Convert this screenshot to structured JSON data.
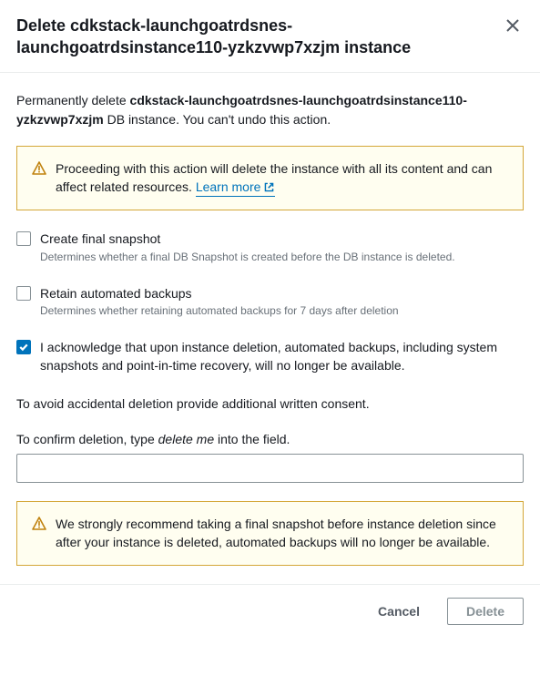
{
  "header": {
    "title": "Delete cdkstack-launchgoatrdsnes-launchgoatrdsinstance110-yzkzvwp7xzjm instance"
  },
  "intro": {
    "prefix": "Permanently delete ",
    "name": "cdkstack-launchgoatrdsnes-launchgoatrdsinstance110-yzkzvwp7xzjm",
    "suffix": " DB instance. You can't undo this action."
  },
  "alert1": {
    "text": "Proceeding with this action will delete the instance with all its content and can affect related resources.",
    "learn_more": "Learn more"
  },
  "options": {
    "snapshot": {
      "label": "Create final snapshot",
      "desc": "Determines whether a final DB Snapshot is created before the DB instance is deleted."
    },
    "retain": {
      "label": "Retain automated backups",
      "desc": "Determines whether retaining automated backups for 7 days after deletion"
    },
    "ack": {
      "label": "I acknowledge that upon instance deletion, automated backups, including system snapshots and point-in-time recovery, will no longer be available."
    }
  },
  "consent_text": "To avoid accidental deletion provide additional written consent.",
  "confirm": {
    "prefix": "To confirm deletion, type ",
    "phrase": "delete me",
    "suffix": " into the field."
  },
  "alert2": {
    "text": "We strongly recommend taking a final snapshot before instance deletion since after your instance is deleted, automated backups will no longer be available."
  },
  "footer": {
    "cancel": "Cancel",
    "delete": "Delete"
  }
}
